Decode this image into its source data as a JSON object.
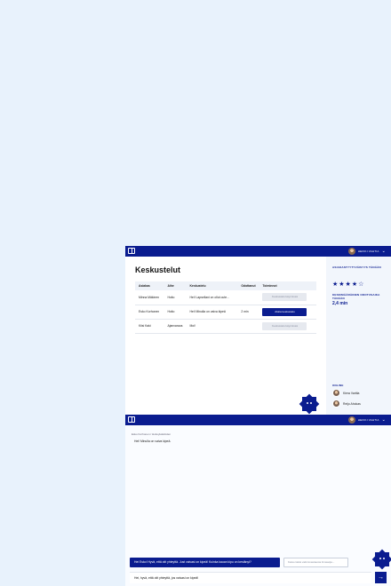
{
  "topbar": {
    "user_name": "HEIKKI VAHTIA"
  },
  "page": {
    "title": "Keskustelut",
    "table": {
      "headers": [
        "Asiakas",
        "Aihe",
        "Keskustelu",
        "Odottanut",
        "Toiminnot"
      ],
      "rows": [
        {
          "customer": "Minna Mäkinen",
          "topic": "Hoito",
          "conversation": "Hei! Lapsellani on ollut oute...",
          "waited": "",
          "action": "Keskustelu käynnissä"
        },
        {
          "customer": "Esko Korhonen",
          "topic": "Hoito",
          "conversation": "Hei! Minulla on vaiva kipeä",
          "waited": "2 min",
          "action": "Aloita keskustelu"
        },
        {
          "customer": "Kiisi Kaki",
          "topic": "Ajanvaraus",
          "conversation": "Moi!",
          "waited": "",
          "action": "Keskustelu käynnissä"
        }
      ]
    }
  },
  "sidebar": {
    "satisfaction_label": "ASIAKASTYYTYVÄISYYS TÄNÄÄN",
    "stars": "★★★★☆",
    "avg_wait_label": "KESKIMÄÄRÄINEN ODOTUSAIKA TÄNÄÄN",
    "avg_wait_value": "2,4 min",
    "online_label": "ONLINE",
    "online_users": [
      "Kiera Varttia",
      "Reijo Ahokas"
    ]
  },
  "chat": {
    "breadcrumb": "Esko Korhonen  /  Hoitoyksiköiden",
    "first_message": "Hei! Minulla on vaiva kipeä.",
    "suggestion": "Hei Esko! Hyvä, että otit yhteyttä. Just vaivasi on kipeä! Kuinka kauan kipu on kestänyt?",
    "search_placeholder": "Katso tästä valmisvastausta ilmasetja...",
    "input_value": "Hei, hyvä, että otit yhteyttä, jos vaivasi on kipeä!",
    "send_icon": "→"
  },
  "colors": {
    "brand": "#0a1c8f",
    "background": "#e8f2fc"
  }
}
